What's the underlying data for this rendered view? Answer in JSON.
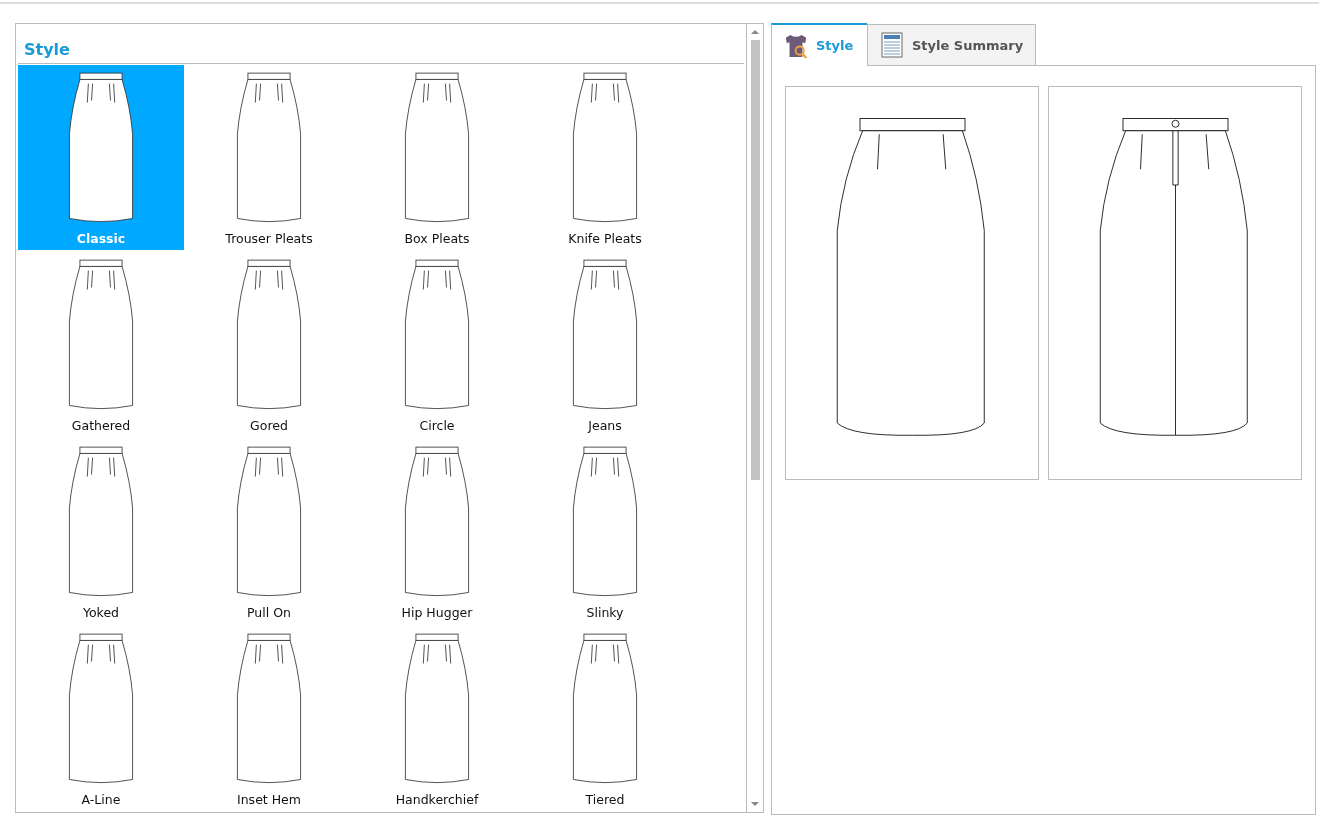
{
  "style_panel": {
    "title": "Style",
    "styles": [
      {
        "label": "Classic",
        "selected": true
      },
      {
        "label": "Trouser Pleats",
        "selected": false
      },
      {
        "label": "Box Pleats",
        "selected": false
      },
      {
        "label": "Knife Pleats",
        "selected": false
      },
      {
        "label": "Gathered",
        "selected": false
      },
      {
        "label": "Gored",
        "selected": false
      },
      {
        "label": "Circle",
        "selected": false
      },
      {
        "label": "Jeans",
        "selected": false
      },
      {
        "label": "Yoked",
        "selected": false
      },
      {
        "label": "Pull On",
        "selected": false
      },
      {
        "label": "Hip Hugger",
        "selected": false
      },
      {
        "label": "Slinky",
        "selected": false
      },
      {
        "label": "A-Line",
        "selected": false
      },
      {
        "label": "Inset Hem",
        "selected": false
      },
      {
        "label": "Handkerchief",
        "selected": false
      },
      {
        "label": "Tiered",
        "selected": false
      }
    ]
  },
  "tabs": [
    {
      "label": "Style",
      "kind": "style",
      "selected": true
    },
    {
      "label": "Style Summary",
      "kind": "summary",
      "selected": false
    }
  ],
  "preview": {
    "views": [
      {
        "kind": "front"
      },
      {
        "kind": "back"
      }
    ]
  }
}
